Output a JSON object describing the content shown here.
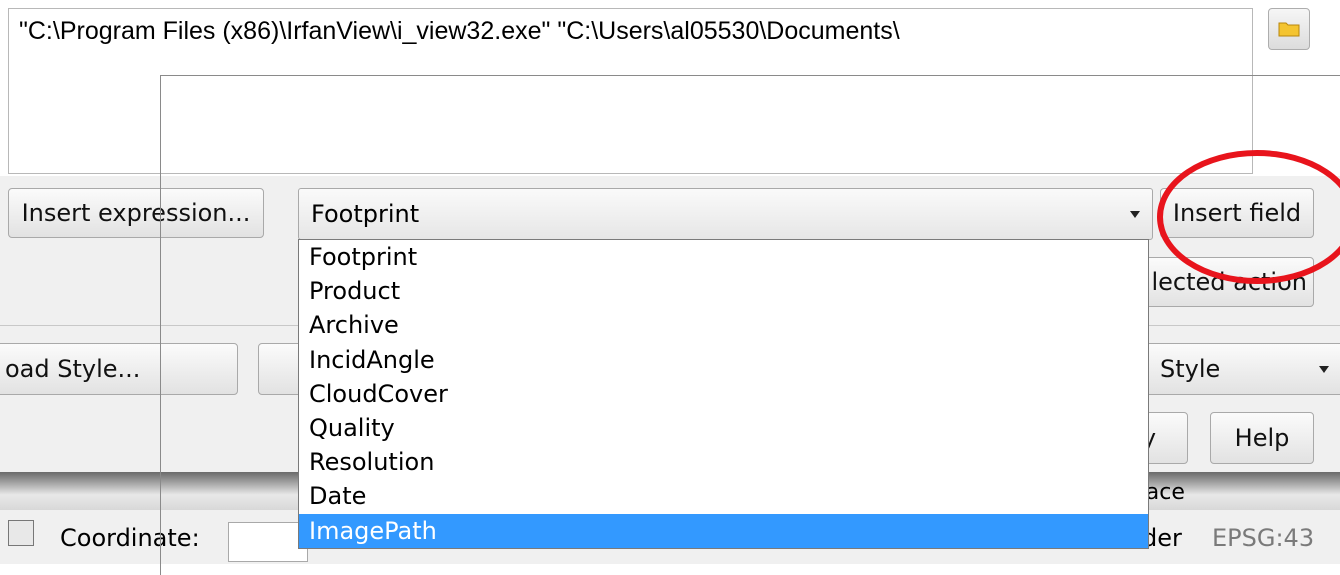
{
  "action": {
    "text": "\"C:\\Program Files (x86)\\IrfanView\\i_view32.exe\" \"C:\\Users\\al05530\\Documents\\"
  },
  "buttons": {
    "insert_expression": "Insert expression...",
    "insert_field": "Insert field",
    "selected_action": "lected action",
    "load_style": "oad Style...",
    "style": "Style",
    "ok": "y",
    "help": "Help"
  },
  "field_combo": {
    "value": "Footprint",
    "options": [
      "Footprint",
      "Product",
      "Archive",
      "IncidAngle",
      "CloudCover",
      "Quality",
      "Resolution",
      "Date",
      "ImagePath"
    ],
    "selected_index": 8
  },
  "status": {
    "surface": "face",
    "coordinate_label": "Coordinate:",
    "render_label": "der",
    "epsg": "EPSG:43"
  },
  "colors": {
    "highlight": "#e8141c",
    "selection": "#3399ff"
  },
  "icons": [
    "folder-icon",
    "chevron-down-icon",
    "mouse-icon"
  ]
}
